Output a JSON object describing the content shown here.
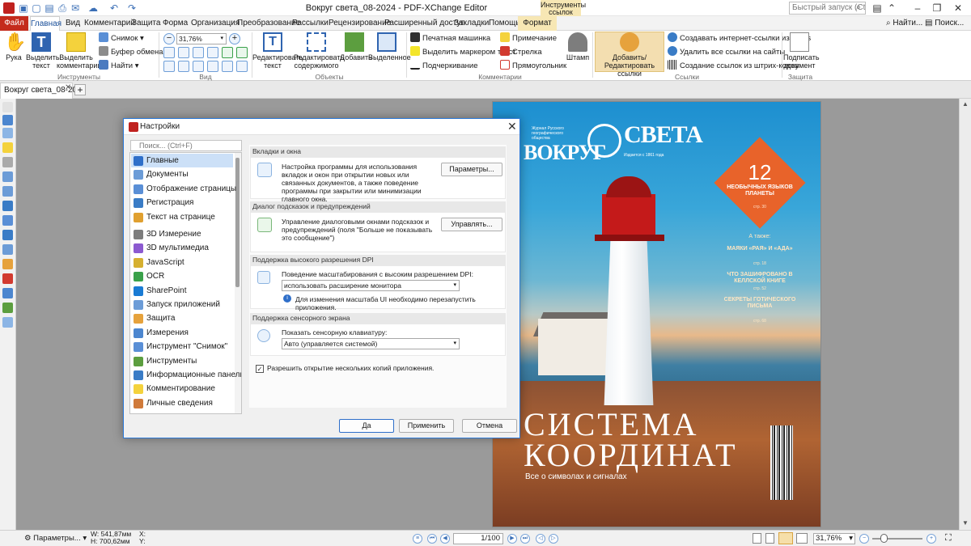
{
  "window": {
    "title": "Вокруг света_08-2024 - PDF-XChange Editor",
    "context_tab": "Инструменты ссылок"
  },
  "quick_search": {
    "placeholder": "Быстрый запуск (Ctrl..."
  },
  "menu": {
    "items": [
      "Файл",
      "Главная",
      "Вид",
      "Комментарий",
      "Защита",
      "Форма",
      "Организация",
      "Преобразование",
      "Рассылки",
      "Рецензирование",
      "Расширенный доступ",
      "Закладки",
      "Помощь",
      "Формат"
    ],
    "find": "Найти...",
    "search": "Поиск..."
  },
  "ribbon": {
    "hand": "Рука",
    "select_text": "Выделить текст",
    "select_comments": "Выделить комментарии",
    "snapshot": "Снимок",
    "clipboard": "Буфер обмена",
    "find": "Найти",
    "zoom": "31,76%",
    "edit_text": "Редактировать текст",
    "edit_content": "Редактировать содержимого",
    "add": "Добавить",
    "selected": "Выделенное",
    "typewriter": "Печатная машинка",
    "highlight": "Выделить маркером текст",
    "underline": "Подчеркивание",
    "note": "Примечание",
    "arrow": "Стрелка",
    "rectangle": "Прямоугольник",
    "stamp": "Штамп",
    "add_edit_links": "Добавить/Редактировать ссылки",
    "create_links_urls": "Создавать интернет-ссылки из URLs",
    "delete_links": "Удалить все ссылки на сайты",
    "create_barcode_links": "Создание ссылок из штрих-кодов",
    "sign": "Подписать документ",
    "groups": {
      "tools": "Инструменты",
      "view": "Вид",
      "objects": "Объекты",
      "comments": "Комментарии",
      "links": "Ссылки",
      "protect": "Защита"
    }
  },
  "doc_tab": {
    "label": "Вокруг света_08-2024"
  },
  "dialog": {
    "title": "Настройки",
    "search_placeholder": "Поиск... (Ctrl+F)",
    "categories": [
      "Главные",
      "Документы",
      "Отображение страницы",
      "Регистрация",
      "Текст на странице",
      "3D Измерение",
      "3D мультимедиа",
      "JavaScript",
      "OCR",
      "SharePoint",
      "Запуск приложений",
      "Защита",
      "Измерения",
      "Инструмент \"Снимок\"",
      "Инструменты",
      "Информационные панели",
      "Комментирование",
      "Личные сведения"
    ],
    "sections": {
      "tabs": {
        "title": "Вкладки и окна",
        "text": "Настройка программы для использования вкладок и окон при открытии новых или связанных документов, а также поведение программы при закрытии или минимизации главного окна.",
        "button": "Параметры..."
      },
      "hints": {
        "title": "Диалог подсказок и предупреждений",
        "text": "Управление диалоговыми окнами подсказок и предупреждений (поля \"Больше не показывать это сообщение\")",
        "button": "Управлять..."
      },
      "dpi": {
        "title": "Поддержка высокого разрешения DPI",
        "label": "Поведение масштабирования с высоким разрешением DPI:",
        "value": "использовать расширение монитора",
        "info": "Для изменения масштаба UI необходимо перезапустить приложения."
      },
      "touch": {
        "title": "Поддержка сенсорного экрана",
        "label": "Показать сенсорную клавиатуру:",
        "value": "Авто (управляется системой)"
      }
    },
    "checkbox": "Разрешить открытие нескольких копий приложения.",
    "buttons": {
      "ok": "Да",
      "apply": "Применить",
      "cancel": "Отмена"
    }
  },
  "magazine": {
    "logo_left": "ВОКРУГ",
    "logo_right": "СВЕТА",
    "tagline": "Журнал Русского географического общества",
    "since": "Издается с 1861 года",
    "badge_number": "12",
    "badge_text": "НЕОБЫЧНЫХ ЯЗЫКОВ ПЛАНЕТЫ",
    "badge_page": "стр. 30",
    "also": "А также:",
    "item1": "МАЯКИ «РАЯ» И «АДА»",
    "item1_page": "стр. 18",
    "item2": "ЧТО ЗАШИФРОВАНО В КЕЛЛСКОЙ КНИГЕ",
    "item2_page": "стр. 52",
    "item3": "СЕКРЕТЫ ГОТИЧЕСКОГО ПИСЬМА",
    "item3_page": "стр. 68",
    "headline1": "СИСТЕМА",
    "headline2": "КООРДИНАТ",
    "subhead": "Все о символах и сигналах"
  },
  "status": {
    "params": "Параметры...",
    "width": "W: 541,87мм",
    "height": "H: 700,62мм",
    "x": "X:",
    "y": "Y:",
    "page": "1/100",
    "zoom": "31,76%"
  }
}
